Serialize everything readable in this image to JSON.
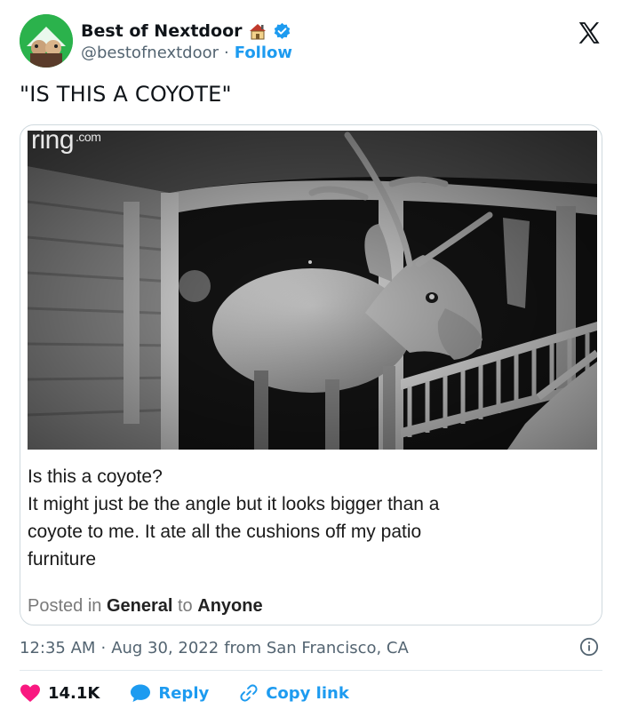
{
  "author": {
    "display_name": "Best of Nextdoor",
    "handle": "@bestofnextdoor",
    "separator": "·",
    "follow_label": "Follow"
  },
  "tweet": {
    "text": "\"IS THIS A COYOTE\""
  },
  "media": {
    "ring_brand": "ring",
    "ring_domain": ".com",
    "post_lines": [
      "Is this a coyote?",
      "It might just be the angle but it looks bigger than a",
      "coyote to me. It ate all the cushions off my patio",
      "furniture"
    ],
    "posted_in_prefix": "Posted in",
    "posted_in_category": "General",
    "posted_to_prefix": "to",
    "posted_to_audience": "Anyone"
  },
  "meta": {
    "time": "12:35 AM",
    "separator": "·",
    "date": "Aug 30, 2022",
    "location": "from San Francisco, CA"
  },
  "actions": {
    "like_count": "14.1K",
    "reply_label": "Reply",
    "copy_link_label": "Copy link"
  },
  "colors": {
    "accent": "#1d9bf0",
    "like": "#f91880",
    "avatar_bg": "#2bb24c"
  },
  "icons": [
    "house-icon",
    "verified-icon",
    "x-logo-icon",
    "info-icon",
    "heart-icon",
    "reply-bubble-icon",
    "link-icon"
  ]
}
